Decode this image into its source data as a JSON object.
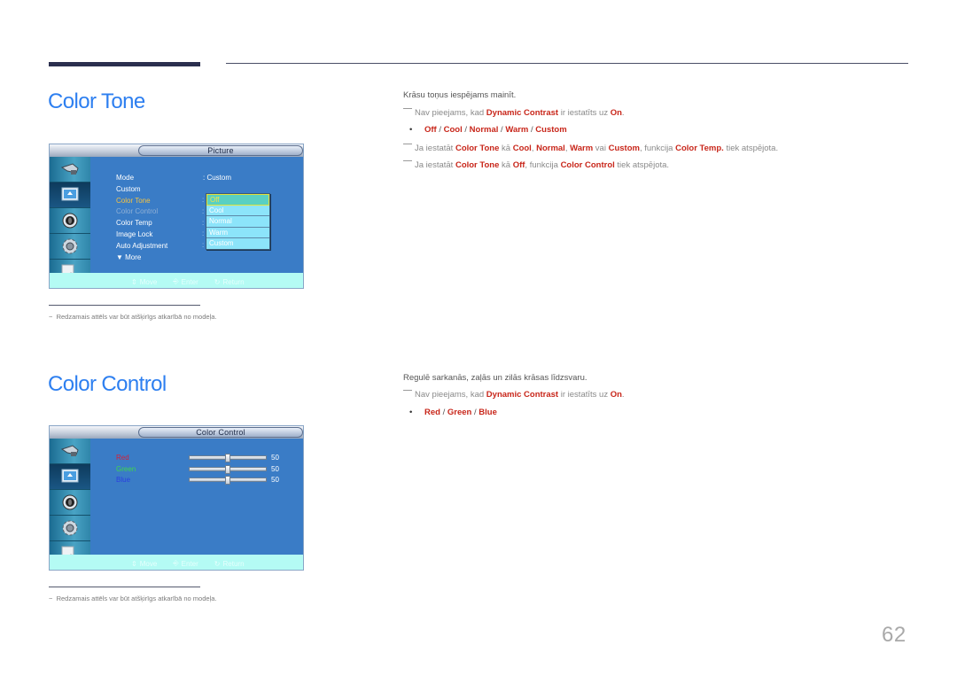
{
  "page_number": "62",
  "sections": {
    "color_tone": {
      "title": "Color Tone",
      "osd": {
        "header": "Picture",
        "menu_items": [
          {
            "label": "Mode",
            "state": "normal"
          },
          {
            "label": "Custom",
            "state": "normal"
          },
          {
            "label": "Color Tone",
            "state": "selected"
          },
          {
            "label": "Color Control",
            "state": "disabled"
          },
          {
            "label": "Color Temp",
            "state": "normal"
          },
          {
            "label": "Image Lock",
            "state": "normal"
          },
          {
            "label": "Auto Adjustment",
            "state": "normal"
          },
          {
            "label": "▼ More",
            "state": "normal"
          }
        ],
        "mode_value": ": Custom",
        "dropdown_options": [
          "Off",
          "Cool",
          "Normal",
          "Warm",
          "Custom"
        ],
        "dropdown_selected": "Off",
        "footer": {
          "move": "Move",
          "enter": "Enter",
          "return": "Return"
        },
        "sidebar_icons": [
          "input-icon",
          "picture-icon",
          "sound-icon",
          "setup-icon",
          "multi-control-icon"
        ]
      },
      "footnote": "Redzamais attēls var būt atšķirīgs atkarībā no modeļa.",
      "description": {
        "intro": "Krāsu toņus iespējams mainīt.",
        "note1": {
          "a": "Nav pieejams, kad ",
          "b": "Dynamic Contrast",
          "c": " ir iestatīts uz ",
          "d": "On",
          "e": "."
        },
        "options": [
          "Off",
          "Cool",
          "Normal",
          "Warm",
          "Custom"
        ],
        "options_separator": " / ",
        "note2": {
          "a": "Ja iestatāt ",
          "b": "Color Tone",
          "c": " kā ",
          "d": "Cool",
          "e": ", ",
          "f": "Normal",
          "g": ", ",
          "h": "Warm",
          "i": " vai ",
          "j": "Custom",
          "k": ", funkcija ",
          "l": "Color Temp.",
          "m": " tiek atspējota."
        },
        "note3": {
          "a": "Ja iestatāt ",
          "b": "Color Tone",
          "c": " kā ",
          "d": "Off",
          "e": ", funkcija ",
          "f": "Color Control",
          "g": " tiek atspējota."
        }
      }
    },
    "color_control": {
      "title": "Color Control",
      "osd": {
        "header": "Color Control",
        "sliders": [
          {
            "label": "Red",
            "value": "50",
            "fraction": 0.5
          },
          {
            "label": "Green",
            "value": "50",
            "fraction": 0.5
          },
          {
            "label": "Blue",
            "value": "50",
            "fraction": 0.5
          }
        ],
        "footer": {
          "move": "Move",
          "enter": "Enter",
          "return": "Return"
        }
      },
      "footnote": "Redzamais attēls var būt atšķirīgs atkarībā no modeļa.",
      "description": {
        "intro": "Regulē sarkanās, zaļās un zilās krāsas līdzsvaru.",
        "note1": {
          "a": "Nav pieejams, kad ",
          "b": "Dynamic Contrast",
          "c": " ir iestatīts uz ",
          "d": "On",
          "e": "."
        },
        "options": [
          "Red",
          "Green",
          "Blue"
        ],
        "options_separator": " / "
      }
    }
  },
  "colors": {
    "title_blue": "#2d7ff0",
    "highlight_red": "#c8261a",
    "osd_bg": "#3a7cc6",
    "osd_footer": "#b4fbf4"
  }
}
